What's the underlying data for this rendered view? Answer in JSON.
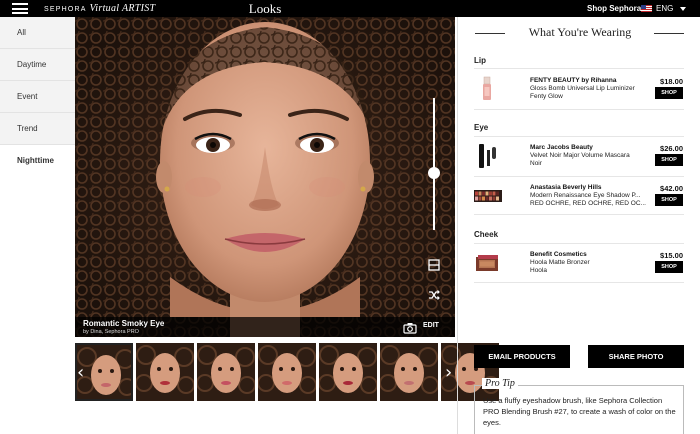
{
  "topbar": {
    "brand": "SEPHORA",
    "brand_sub": "Virtual ARTIST",
    "title": "Looks",
    "shop_link": "Shop Sephora",
    "language": "ENG"
  },
  "filters": [
    {
      "label": "All"
    },
    {
      "label": "Daytime"
    },
    {
      "label": "Event"
    },
    {
      "label": "Trend"
    },
    {
      "label": "Nighttime",
      "active": true
    }
  ],
  "look": {
    "name": "Romantic Smoky Eye",
    "by": "by Dina, Sephora PRO",
    "edit_label": "EDIT"
  },
  "thumbnails": {
    "count": 7,
    "selected_index": 0,
    "lip_colors": [
      "#c4666a",
      "#b0303a",
      "#c45060",
      "#d06a6a",
      "#a82838",
      "#c27070",
      "#b84a50"
    ]
  },
  "panel": {
    "title": "What You're Wearing",
    "sections": [
      {
        "label": "Lip",
        "products": [
          {
            "brand": "FENTY BEAUTY by Rihanna",
            "name": "Gloss Bomb Universal Lip Luminizer",
            "shade": "Fenty Glow",
            "price": "$18.00",
            "shop": "SHOP",
            "icon": "lip-gloss-icon"
          }
        ]
      },
      {
        "label": "Eye",
        "products": [
          {
            "brand": "Marc Jacobs Beauty",
            "name": "Velvet Noir Major Volume Mascara",
            "shade": "Noir",
            "price": "$26.00",
            "shop": "SHOP",
            "icon": "mascara-icon"
          },
          {
            "brand": "Anastasia Beverly Hills",
            "name": "Modern Renaissance Eye Shadow P...",
            "shade": "RED OCHRE, RED OCHRE, RED OC...",
            "price": "$42.00",
            "shop": "SHOP",
            "icon": "eyeshadow-palette-icon"
          }
        ]
      },
      {
        "label": "Cheek",
        "products": [
          {
            "brand": "Benefit Cosmetics",
            "name": "Hoola Matte Bronzer",
            "shade": "Hoola",
            "price": "$15.00",
            "shop": "SHOP",
            "icon": "bronzer-icon"
          }
        ]
      }
    ],
    "email_button": "EMAIL PRODUCTS",
    "share_button": "SHARE PHOTO",
    "protip_title": "Pro Tip",
    "protip_text": "Use a fluffy eyeshadow brush, like Sephora Collection PRO Blending Brush #27, to create a wash of color on the eyes."
  },
  "colors": {
    "topbar_bg": "#000000",
    "button_bg": "#000000",
    "nav_bg": "#f3f3f3"
  }
}
